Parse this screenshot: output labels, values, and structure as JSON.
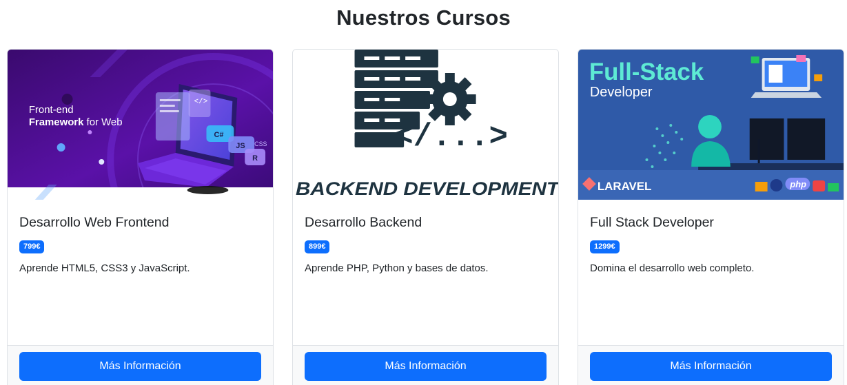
{
  "page": {
    "title": "Nuestros Cursos"
  },
  "colors": {
    "primary": "#0d6efd",
    "text": "#212529",
    "border": "#dee2e6"
  },
  "courses": [
    {
      "image": {
        "line1": "Front-end",
        "line2_bold": "Framework",
        "line2_rest": " for Web",
        "tags": [
          "C#",
          "JS",
          "R",
          "CSS"
        ]
      },
      "title": "Desarrollo Web Frontend",
      "price": "799€",
      "description": "Aprende HTML5, CSS3 y JavaScript.",
      "button": "Más Información"
    },
    {
      "image": {
        "code": "</...>",
        "caption": "BACKEND DEVELOPMENT"
      },
      "title": "Desarrollo Backend",
      "price": "899€",
      "description": "Aprende PHP, Python y bases de datos.",
      "button": "Más Información"
    },
    {
      "image": {
        "line1": "Full-Stack",
        "line2": "Developer",
        "logo": "LARAVEL",
        "tag": "php"
      },
      "title": "Full Stack Developer",
      "price": "1299€",
      "description": "Domina el desarrollo web completo.",
      "button": "Más Información"
    }
  ]
}
